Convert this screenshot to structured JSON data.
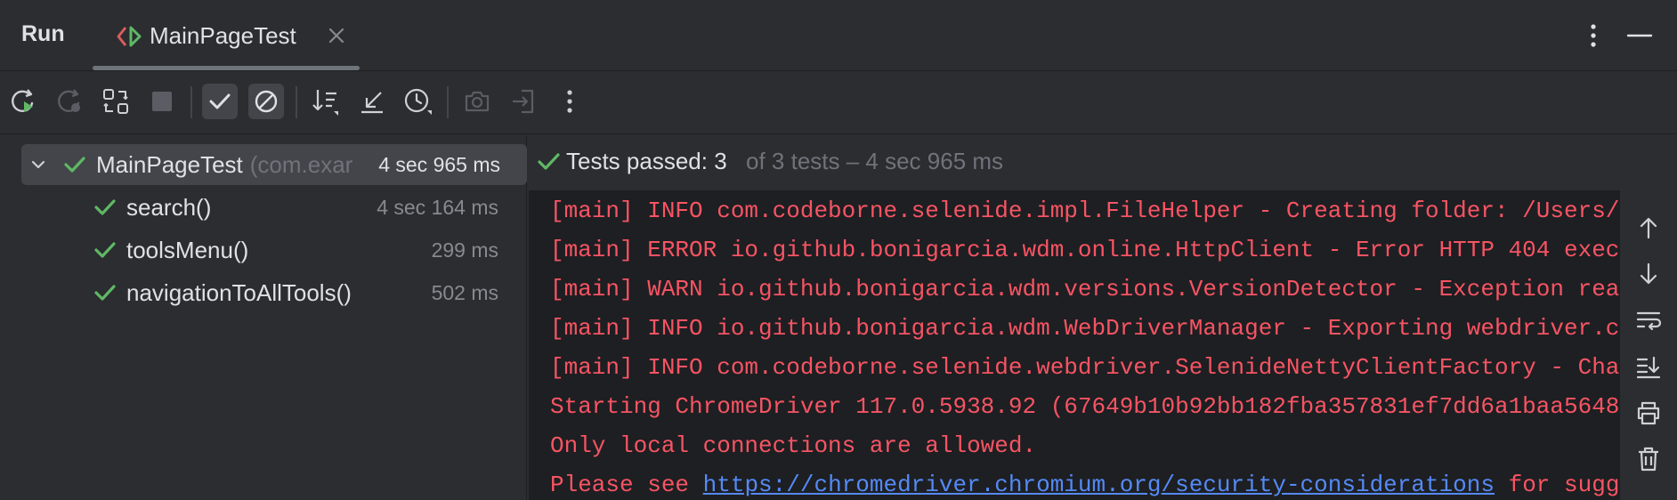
{
  "header": {
    "title": "Run",
    "tab_label": "MainPageTest"
  },
  "toolbar": {
    "buttons": [
      "rerun-icon",
      "rerun-failed-icon",
      "toggle-auto-test-icon",
      "stop-icon",
      "show-passed-icon",
      "show-ignored-icon",
      "sort-icon",
      "collapse-icon",
      "history-icon",
      "screenshot-icon",
      "export-icon",
      "more-icon"
    ]
  },
  "tree": {
    "root": {
      "name": "MainPageTest",
      "package": "(com.exar",
      "time": "4 sec 965 ms"
    },
    "tests": [
      {
        "name": "search()",
        "time": "4 sec 164 ms"
      },
      {
        "name": "toolsMenu()",
        "time": "299 ms"
      },
      {
        "name": "navigationToAllTools()",
        "time": "502 ms"
      }
    ]
  },
  "status": {
    "main": "Tests passed: 3",
    "sub": "of 3 tests – 4 sec 965 ms"
  },
  "console": {
    "lines": [
      "[main] INFO com.codeborne.selenide.impl.FileHelper - Creating folder: /Users/",
      "[main] ERROR io.github.bonigarcia.wdm.online.HttpClient - Error HTTP 404 exec",
      "[main] WARN io.github.bonigarcia.wdm.versions.VersionDetector - Exception rea",
      "[main] INFO io.github.bonigarcia.wdm.WebDriverManager - Exporting webdriver.c",
      "[main] INFO com.codeborne.selenide.webdriver.SelenideNettyClientFactory - Cha",
      "Starting ChromeDriver 117.0.5938.92 (67649b10b92bb182fba357831ef7dd6a1baa5648",
      "Only local connections are allowed."
    ],
    "last_prefix": "Please see ",
    "last_link": "https://chromedriver.chromium.org/security-considerations",
    "last_suffix": " for sugg"
  },
  "colors": {
    "background": "#2b2d30",
    "console_bg": "#1e1f22",
    "pass_green": "#5fb865",
    "error_red": "#f75464",
    "link_blue": "#548af7"
  },
  "side_tools": [
    "scroll-up-icon",
    "scroll-down-icon",
    "soft-wrap-icon",
    "scroll-to-end-icon",
    "print-icon",
    "clear-icon"
  ]
}
